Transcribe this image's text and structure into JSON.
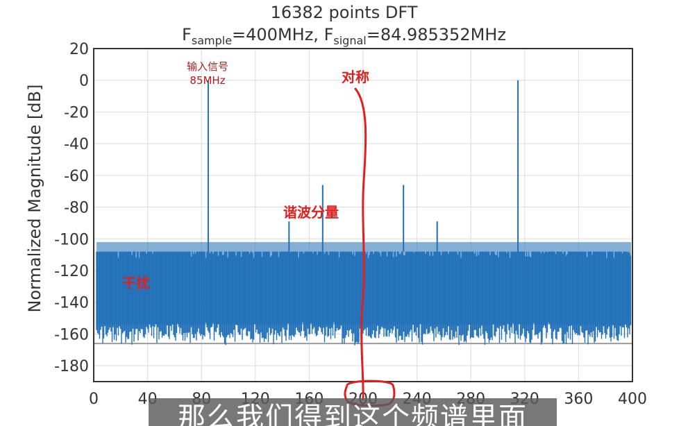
{
  "title": "16382 points DFT",
  "subtitle": {
    "f1": "F",
    "f1_sub": "sample",
    "f1_rest": "=400MHz, ",
    "f2": "F",
    "f2_sub": "signal",
    "f2_rest": "=84.985352MHz"
  },
  "annotations": {
    "input_signal": "输入信号",
    "input_freq": "85MHz",
    "symmetry": "对称",
    "harmonics": "谐波分量",
    "interference": "干扰"
  },
  "caption": "那么我们得到这个频谱里面",
  "colors": {
    "line": "#1f6fb8",
    "annotation": "#e0201e",
    "annotation_dark": "#b01c1c",
    "frame": "#333333"
  },
  "chart_data": {
    "type": "line",
    "title": "16382 points DFT",
    "subtitle": "Fsample=400MHz, Fsignal=84.985352MHz",
    "xlabel": "",
    "ylabel": "Normalized Magnitude [dB]",
    "xlim": [
      0,
      400
    ],
    "ylim": [
      -190,
      20
    ],
    "xticks": [
      0,
      40,
      80,
      120,
      160,
      200,
      240,
      280,
      320,
      360,
      400
    ],
    "yticks": [
      20,
      0,
      -20,
      -40,
      -60,
      -80,
      -100,
      -120,
      -140,
      -160,
      -180
    ],
    "grid": true,
    "reference_line_y": -166,
    "noise_floor": {
      "top": -108,
      "bottom": -162
    },
    "peaks": [
      {
        "x": 85,
        "y": 0
      },
      {
        "x": 145,
        "y": -89
      },
      {
        "x": 170,
        "y": -66
      },
      {
        "x": 230,
        "y": -66
      },
      {
        "x": 255,
        "y": -89
      },
      {
        "x": 315,
        "y": 0
      }
    ]
  }
}
